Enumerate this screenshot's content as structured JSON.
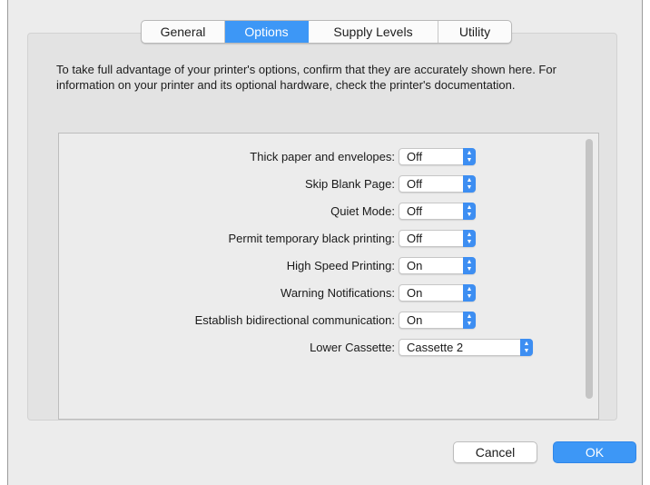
{
  "tabs": [
    {
      "label": "General",
      "active": false
    },
    {
      "label": "Options",
      "active": true
    },
    {
      "label": "Supply Levels",
      "active": false
    },
    {
      "label": "Utility",
      "active": false
    }
  ],
  "description": "To take full advantage of your printer's options, confirm that they are accurately shown here. For information on your printer and its optional hardware, check the printer's documentation.",
  "options": [
    {
      "label": "Thick paper and envelopes:",
      "value": "Off"
    },
    {
      "label": "Skip Blank Page:",
      "value": "Off"
    },
    {
      "label": "Quiet Mode:",
      "value": "Off"
    },
    {
      "label": "Permit temporary black printing:",
      "value": "Off"
    },
    {
      "label": "High Speed Printing:",
      "value": "On"
    },
    {
      "label": "Warning Notifications:",
      "value": "On"
    },
    {
      "label": "Establish bidirectional communication:",
      "value": "On"
    },
    {
      "label": "Lower Cassette:",
      "value": "Cassette 2"
    }
  ],
  "buttons": {
    "cancel": "Cancel",
    "ok": "OK"
  },
  "colors": {
    "accent": "#3d97f6",
    "window_bg": "#ececec"
  }
}
